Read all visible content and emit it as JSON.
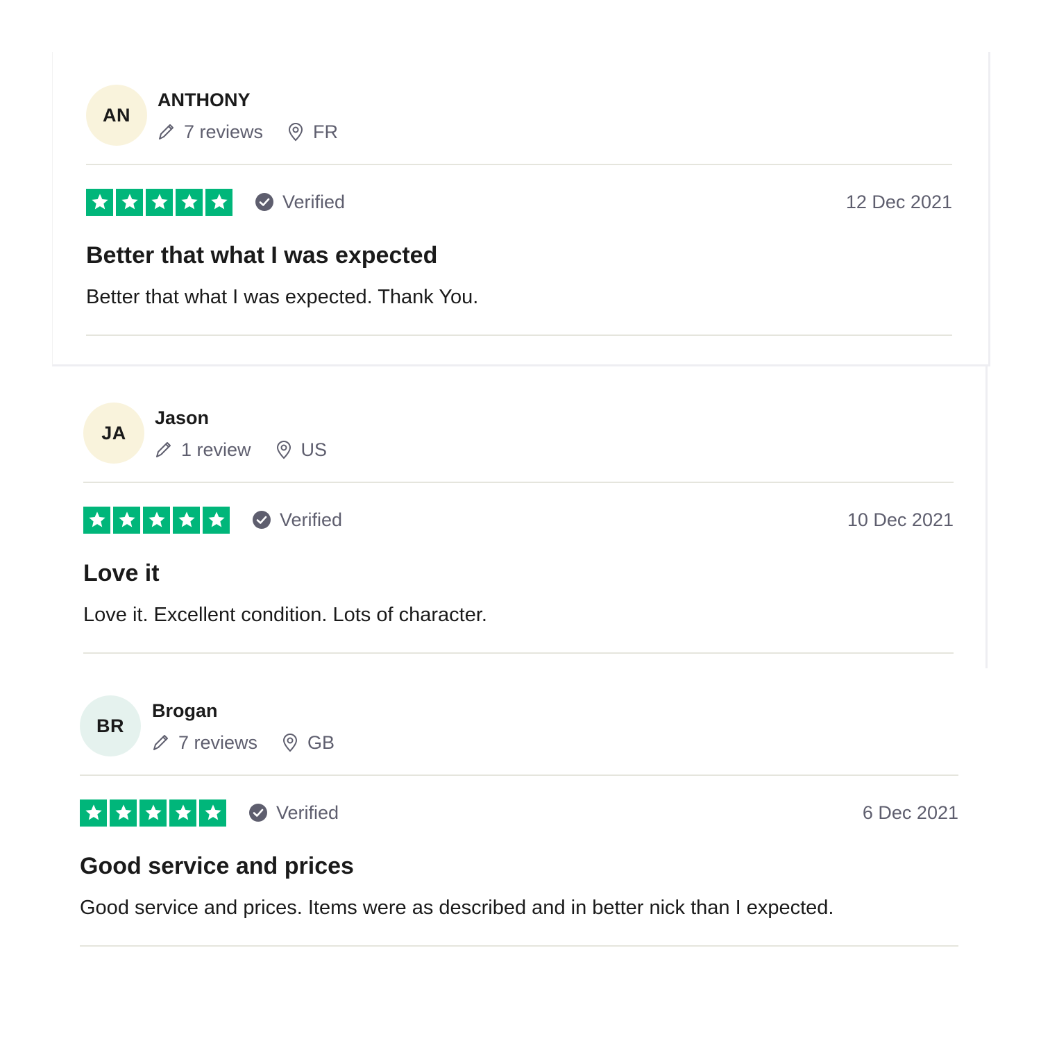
{
  "colors": {
    "star_green": "#00b67a",
    "muted_text": "#5e5e6e",
    "avatar_yellow": "#f9f3dc",
    "avatar_mint": "#e5f2ee",
    "divider": "#e5e5dd"
  },
  "reviews": [
    {
      "initials": "AN",
      "name": "ANTHONY",
      "review_count": "7 reviews",
      "country": "FR",
      "rating": 5,
      "verified_label": "Verified",
      "date": "12 Dec 2021",
      "title": "Better that what I was expected",
      "text": "Better that what I was expected. Thank You."
    },
    {
      "initials": "JA",
      "name": "Jason",
      "review_count": "1 review",
      "country": "US",
      "rating": 5,
      "verified_label": "Verified",
      "date": "10 Dec 2021",
      "title": "Love it",
      "text": "Love it. Excellent condition. Lots of character."
    },
    {
      "initials": "BR",
      "name": "Brogan",
      "review_count": "7 reviews",
      "country": "GB",
      "rating": 5,
      "verified_label": "Verified",
      "date": "6 Dec 2021",
      "title": "Good service and prices",
      "text": "Good service and prices. Items were as described and in better nick than I expected."
    }
  ],
  "icons": {
    "review_count": "pencil-icon",
    "country": "location-pin-icon",
    "verified": "verified-check-icon",
    "star": "star-icon"
  }
}
